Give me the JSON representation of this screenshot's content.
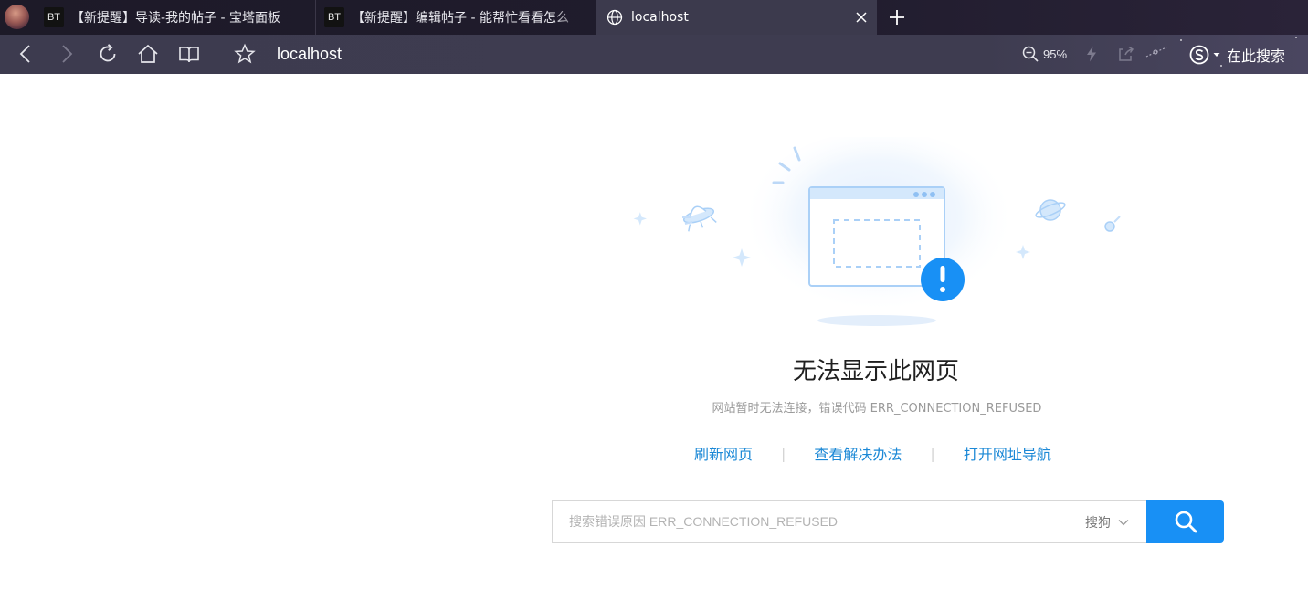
{
  "tabs": [
    {
      "favicon": "BT",
      "title": "【新提醒】导读-我的帖子 - 宝塔面板",
      "active": false
    },
    {
      "favicon": "BT",
      "title": "【新提醒】编辑帖子 - 能帮忙看看怎么",
      "active": false
    },
    {
      "favicon": "globe-icon",
      "title": "localhost",
      "active": true
    }
  ],
  "toolbar": {
    "address": "localhost",
    "zoom": "95%",
    "search_label": "在此搜索"
  },
  "error": {
    "title": "无法显示此网页",
    "subtitle": "网站暂时无法连接，错误代码 ERR_CONNECTION_REFUSED",
    "actions": {
      "refresh": "刷新网页",
      "solutions": "查看解决办法",
      "nav": "打开网址导航"
    }
  },
  "search": {
    "placeholder": "搜索错误原因 ERR_CONNECTION_REFUSED",
    "engine": "搜狗"
  },
  "colors": {
    "accent": "#1890f5",
    "link": "#1b88d6",
    "tabstrip": "#1d1a28",
    "toolbar": "#3d3b4f"
  }
}
